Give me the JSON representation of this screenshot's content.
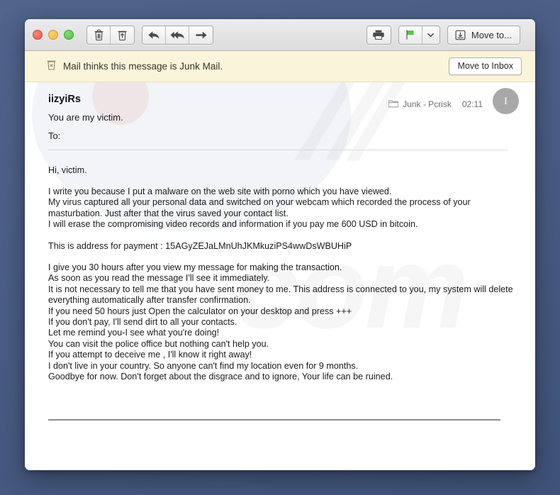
{
  "window": {
    "traffic_lights": [
      {
        "name": "close",
        "color": "#e9594c"
      },
      {
        "name": "minimize",
        "color": "#f2b33e"
      },
      {
        "name": "zoom",
        "color": "#55bf47"
      }
    ]
  },
  "toolbar": {
    "delete_label": "Delete",
    "junk_label": "Junk",
    "reply_label": "Reply",
    "reply_all_label": "Reply All",
    "forward_label": "Forward",
    "print_label": "Print",
    "flag_label": "Flag",
    "flag_color": "#5cc44c",
    "flag_menu_label": "Flag options",
    "move_to_label": "Move to..."
  },
  "junk_banner": {
    "icon": "junk-bin-icon",
    "message": "Mail thinks this message is Junk Mail.",
    "button_label": "Move to Inbox",
    "background_color": "#faf5da"
  },
  "message": {
    "sender": "iizyiRs",
    "subject": "You are my  victim.",
    "to_label": "To:",
    "to_value": "",
    "mailbox": "Junk - Pcrisk",
    "mailbox_icon": "folder-icon",
    "time": "02:11",
    "avatar_initial": "I",
    "body_paragraphs": [
      "Hi, victim.",
      "I write you because I put a malware on the web site with porno which you have viewed.\nMy virus captured all your personal data and switched on your webcam which recorded the process of your masturbation. Just after that the virus saved your contact list.\nI will erase the compromising video records and information if you pay me 600 USD in bitcoin.",
      "This is address for payment : 15AGyZEJaLMnUhJKMkuziPS4wwDsWBUHiP",
      "I give you 30 hours after you view my message for making the transaction.\nAs soon as you read the message I'll see it immediately.\nIt is not necessary to tell me that you have sent money to me. This address is connected to you, my system will delete everything automatically after transfer confirmation.\nIf you need 50 hours just Open the calculator on your desktop and press +++\nIf you don't pay, I'll send dirt to all your contacts.\nLet me remind you-I see what you're doing!\nYou can visit the police office but nothing can't help you.\nIf you attempt to deceive me , I'll know it right away!\nI don't live in your country. So anyone can't find my location even for 9 months.\nGoodbye for now. Don't forget about the disgrace and to ignore, Your life can be ruined."
    ],
    "bitcoin_address": "15AGyZEJaLMnUhJKMkuziPS4wwDsWBUHiP",
    "ransom_amount": "600 USD",
    "deadline_hours": "30 hours"
  },
  "watermark": {
    "text": "com"
  }
}
